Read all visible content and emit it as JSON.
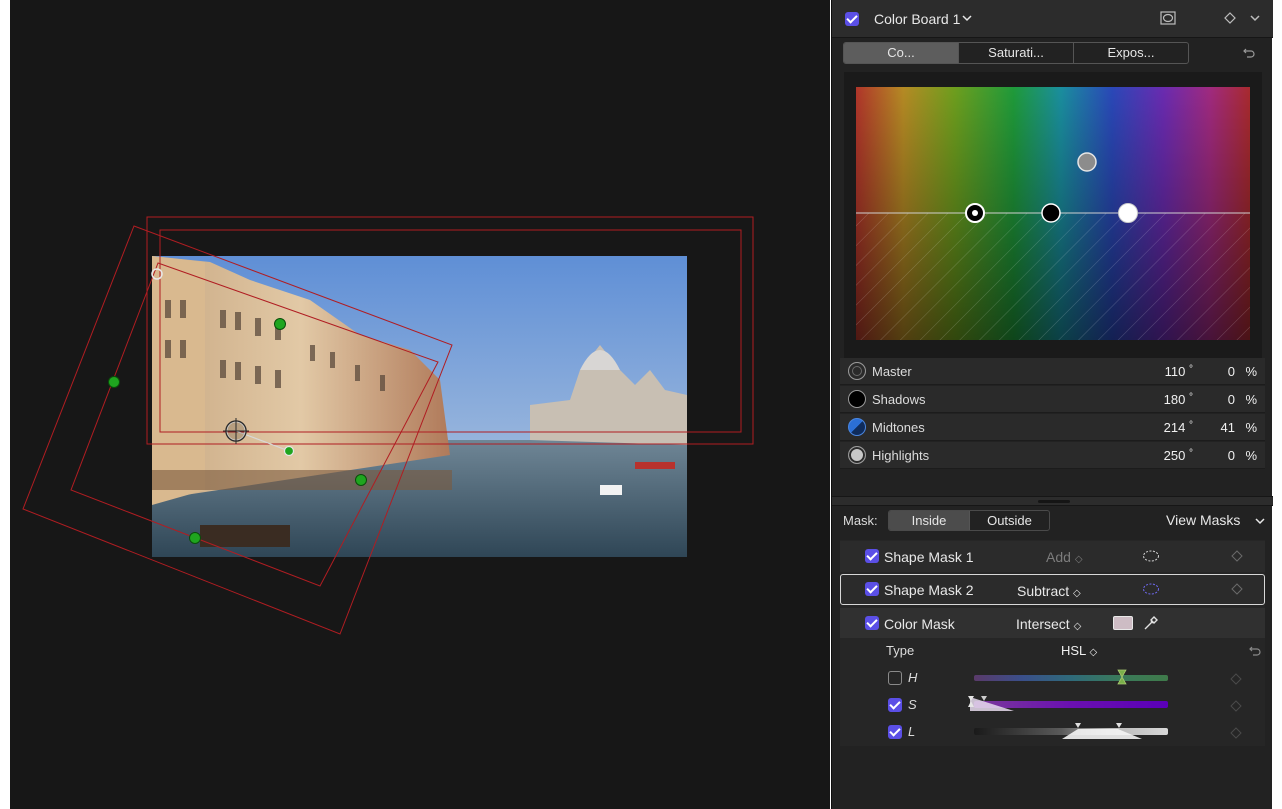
{
  "effect": {
    "title": "Color Board 1",
    "icons": {
      "mask": "shape-mask-icon",
      "keyframe": "keyframe-diamond-icon",
      "disclosure": "chevron-down-icon"
    }
  },
  "tabs": [
    {
      "label": "Co...",
      "active": true
    },
    {
      "label": "Saturati...",
      "active": false
    },
    {
      "label": "Expos...",
      "active": false
    }
  ],
  "tones": [
    {
      "label": "Master",
      "degrees": "110",
      "degree_unit": "°",
      "percent": "0",
      "percent_unit": "%"
    },
    {
      "label": "Shadows",
      "degrees": "180",
      "degree_unit": "°",
      "percent": "0",
      "percent_unit": "%"
    },
    {
      "label": "Midtones",
      "degrees": "214",
      "degree_unit": "°",
      "percent": "41",
      "percent_unit": "%"
    },
    {
      "label": "Highlights",
      "degrees": "250",
      "degree_unit": "°",
      "percent": "0",
      "percent_unit": "%"
    }
  ],
  "mask_bar": {
    "label": "Mask:",
    "inside": "Inside",
    "outside": "Outside",
    "active": "Inside",
    "view_masks": "View Masks"
  },
  "masks": [
    {
      "name": "Shape Mask 1",
      "mode": "Add",
      "enabled": true,
      "selected": false,
      "mode_dimmed": true
    },
    {
      "name": "Shape Mask 2",
      "mode": "Subtract",
      "enabled": true,
      "selected": true,
      "mode_dimmed": false
    },
    {
      "name": "Color Mask",
      "mode": "Intersect",
      "enabled": true,
      "selected": false,
      "mode_dimmed": false
    }
  ],
  "color_mask": {
    "type_label": "Type",
    "type_value": "HSL",
    "channels": [
      {
        "label": "H",
        "enabled": false
      },
      {
        "label": "S",
        "enabled": true
      },
      {
        "label": "L",
        "enabled": true
      }
    ]
  },
  "colors": {
    "accent": "#5b4fe6",
    "mask_shape_red": "#b01d22",
    "handle_green": "#1fa51f"
  }
}
